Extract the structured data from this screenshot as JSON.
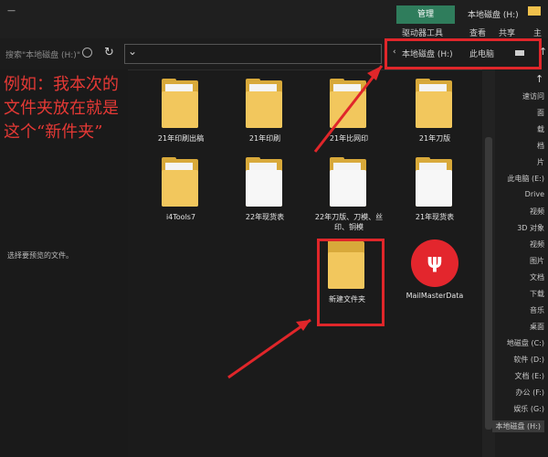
{
  "titlebar": {
    "manage_tab": "管理",
    "window_title": "本地磁盘 (H:)",
    "minimize": "—"
  },
  "ribbon": {
    "tabs": [
      "主页",
      "共享",
      "查看",
      "驱动器工具"
    ]
  },
  "address": {
    "crumbs": [
      "此电脑",
      "本地磁盘 (H:)"
    ],
    "search_placeholder": "搜索\"本地磁盘 (H:)\"",
    "refresh": "↻",
    "dropdown": "⌄",
    "back": "←",
    "forward": "→",
    "up": "↑"
  },
  "annotation": {
    "text": "例如：我本次的文件夹放在就是这个“新件夹”"
  },
  "details_hint": "选择要预览的文件。",
  "items": [
    {
      "label": "21年印刷出稿",
      "type": "folder"
    },
    {
      "label": "21年印刷",
      "type": "folder"
    },
    {
      "label": "21年比网印",
      "type": "folder"
    },
    {
      "label": "21年刀版",
      "type": "folder"
    },
    {
      "label": "i4Tools7",
      "type": "folder"
    },
    {
      "label": "22年现货表",
      "type": "doc"
    },
    {
      "label": "22年刀版、刀模、丝印、铜模",
      "type": "doc"
    },
    {
      "label": "21年现货表",
      "type": "doc"
    },
    {
      "label": "新建文件夹",
      "type": "folder"
    },
    {
      "label": "MailMasterData",
      "type": "mailmaster"
    }
  ],
  "nav_pane": {
    "items": [
      "速访问",
      "面",
      "载",
      "档",
      "片",
      "此电脑 (E:)",
      "Drive",
      "视频",
      "3D 对象",
      "视频",
      "图片",
      "文档",
      "下载",
      "音乐",
      "桌面",
      "地磁盘 (C:)",
      "软件 (D:)",
      "文档 (E:)",
      "办公 (F:)",
      "娱乐 (G:)",
      "本地磁盘 (H:)"
    ]
  },
  "colors": {
    "accent_red": "#e0262a",
    "manage_green": "#2f7d5c",
    "folder_yellow": "#f2c75d"
  }
}
